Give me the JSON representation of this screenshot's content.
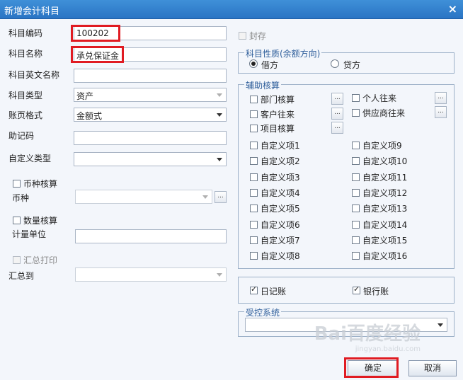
{
  "window": {
    "title": "新增会计科目",
    "close_glyph": "×"
  },
  "left": {
    "code": {
      "label": "科目编码",
      "value": "100202"
    },
    "name": {
      "label": "科目名称",
      "value": "承兑保证金"
    },
    "english_name": {
      "label": "科目英文名称",
      "value": ""
    },
    "type": {
      "label": "科目类型",
      "value": "资产"
    },
    "page_format": {
      "label": "账页格式",
      "value": "金额式"
    },
    "mnemonic": {
      "label": "助记码",
      "value": ""
    },
    "custom_type": {
      "label": "自定义类型",
      "value": ""
    },
    "currency_accounting": {
      "label": "币种核算",
      "checked": false
    },
    "currency": {
      "label": "币种",
      "value": ""
    },
    "quantity_accounting": {
      "label": "数量核算",
      "checked": false
    },
    "unit": {
      "label": "计量单位",
      "value": ""
    },
    "summary_print": {
      "label": "汇总打印",
      "checked": false
    },
    "summary_to": {
      "label": "汇总到",
      "value": ""
    }
  },
  "right": {
    "sealed": {
      "label": "封存",
      "checked": false
    },
    "nature": {
      "legend": "科目性质(余额方向)",
      "debit_label": "借方",
      "credit_label": "贷方",
      "selected": "debit"
    },
    "aux": {
      "legend": "辅助核算",
      "items": {
        "dept": "部门核算",
        "personal": "个人往来",
        "customer": "客户往来",
        "supplier": "供应商往来",
        "project": "项目核算"
      },
      "dots": "...",
      "custom_left": [
        "自定义项1",
        "自定义项2",
        "自定义项3",
        "自定义项4",
        "自定义项5",
        "自定义项6",
        "自定义项7",
        "自定义项8"
      ],
      "custom_right": [
        "自定义项9",
        "自定义项10",
        "自定义项11",
        "自定义项12",
        "自定义项13",
        "自定义项14",
        "自定义项15",
        "自定义项16"
      ]
    },
    "journal": {
      "label": "日记账",
      "checked": true
    },
    "bank": {
      "label": "银行账",
      "checked": true
    },
    "controlled": {
      "legend": "受控系统",
      "value": ""
    }
  },
  "buttons": {
    "ok": "确定",
    "cancel": "取消"
  },
  "watermark": {
    "main": "Bai百度经验",
    "sub": "jingyan.baidu.com"
  }
}
